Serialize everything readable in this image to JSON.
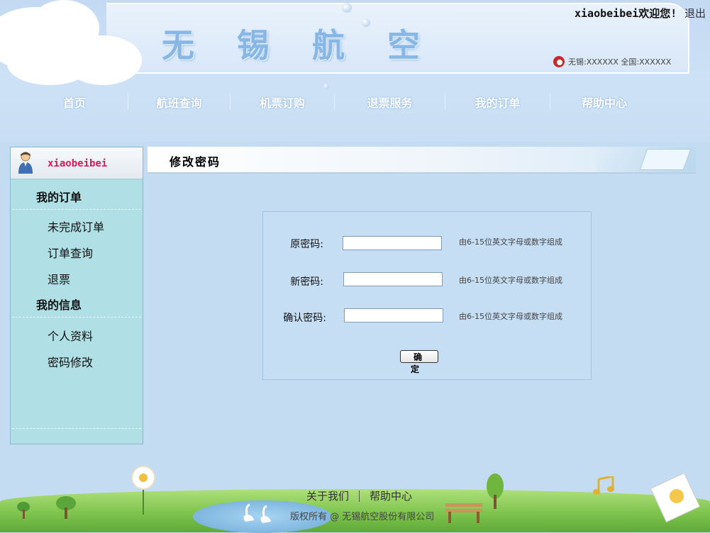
{
  "header": {
    "brand_title": "无 锡 航 空",
    "welcome": "xiaobeibei欢迎您!",
    "logout": "退出",
    "hotline": "无锡:XXXXXX 全国:XXXXXX"
  },
  "nav": {
    "items": [
      "首页",
      "航班查询",
      "机票订购",
      "退票服务",
      "我的订单",
      "帮助中心"
    ]
  },
  "sidebar": {
    "username": "xiaobeibei",
    "orders_heading": "我的订单",
    "order_links": [
      "未完成订单",
      "订单查询",
      "退票"
    ],
    "info_heading": "我的信息",
    "info_links": [
      "个人资料",
      "密码修改"
    ]
  },
  "main": {
    "title": "修改密码",
    "fields": [
      {
        "label": "原密码:",
        "value": "",
        "hint": "由6-15位英文字母或数字组成"
      },
      {
        "label": "新密码:",
        "value": "",
        "hint": "由6-15位英文字母或数字组成"
      },
      {
        "label": "确认密码:",
        "value": "",
        "hint": "由6-15位英文字母或数字组成"
      }
    ],
    "confirm_button": "确 定"
  },
  "footer": {
    "links": [
      "关于我们",
      "帮助中心"
    ],
    "copyright": "版权所有 @ 无锡航空股份有限公司"
  },
  "colors": {
    "background": "#c3dcf2",
    "sidebar": "#b0e0e6",
    "username": "#e0185a",
    "nav_text": "#ffffff"
  }
}
